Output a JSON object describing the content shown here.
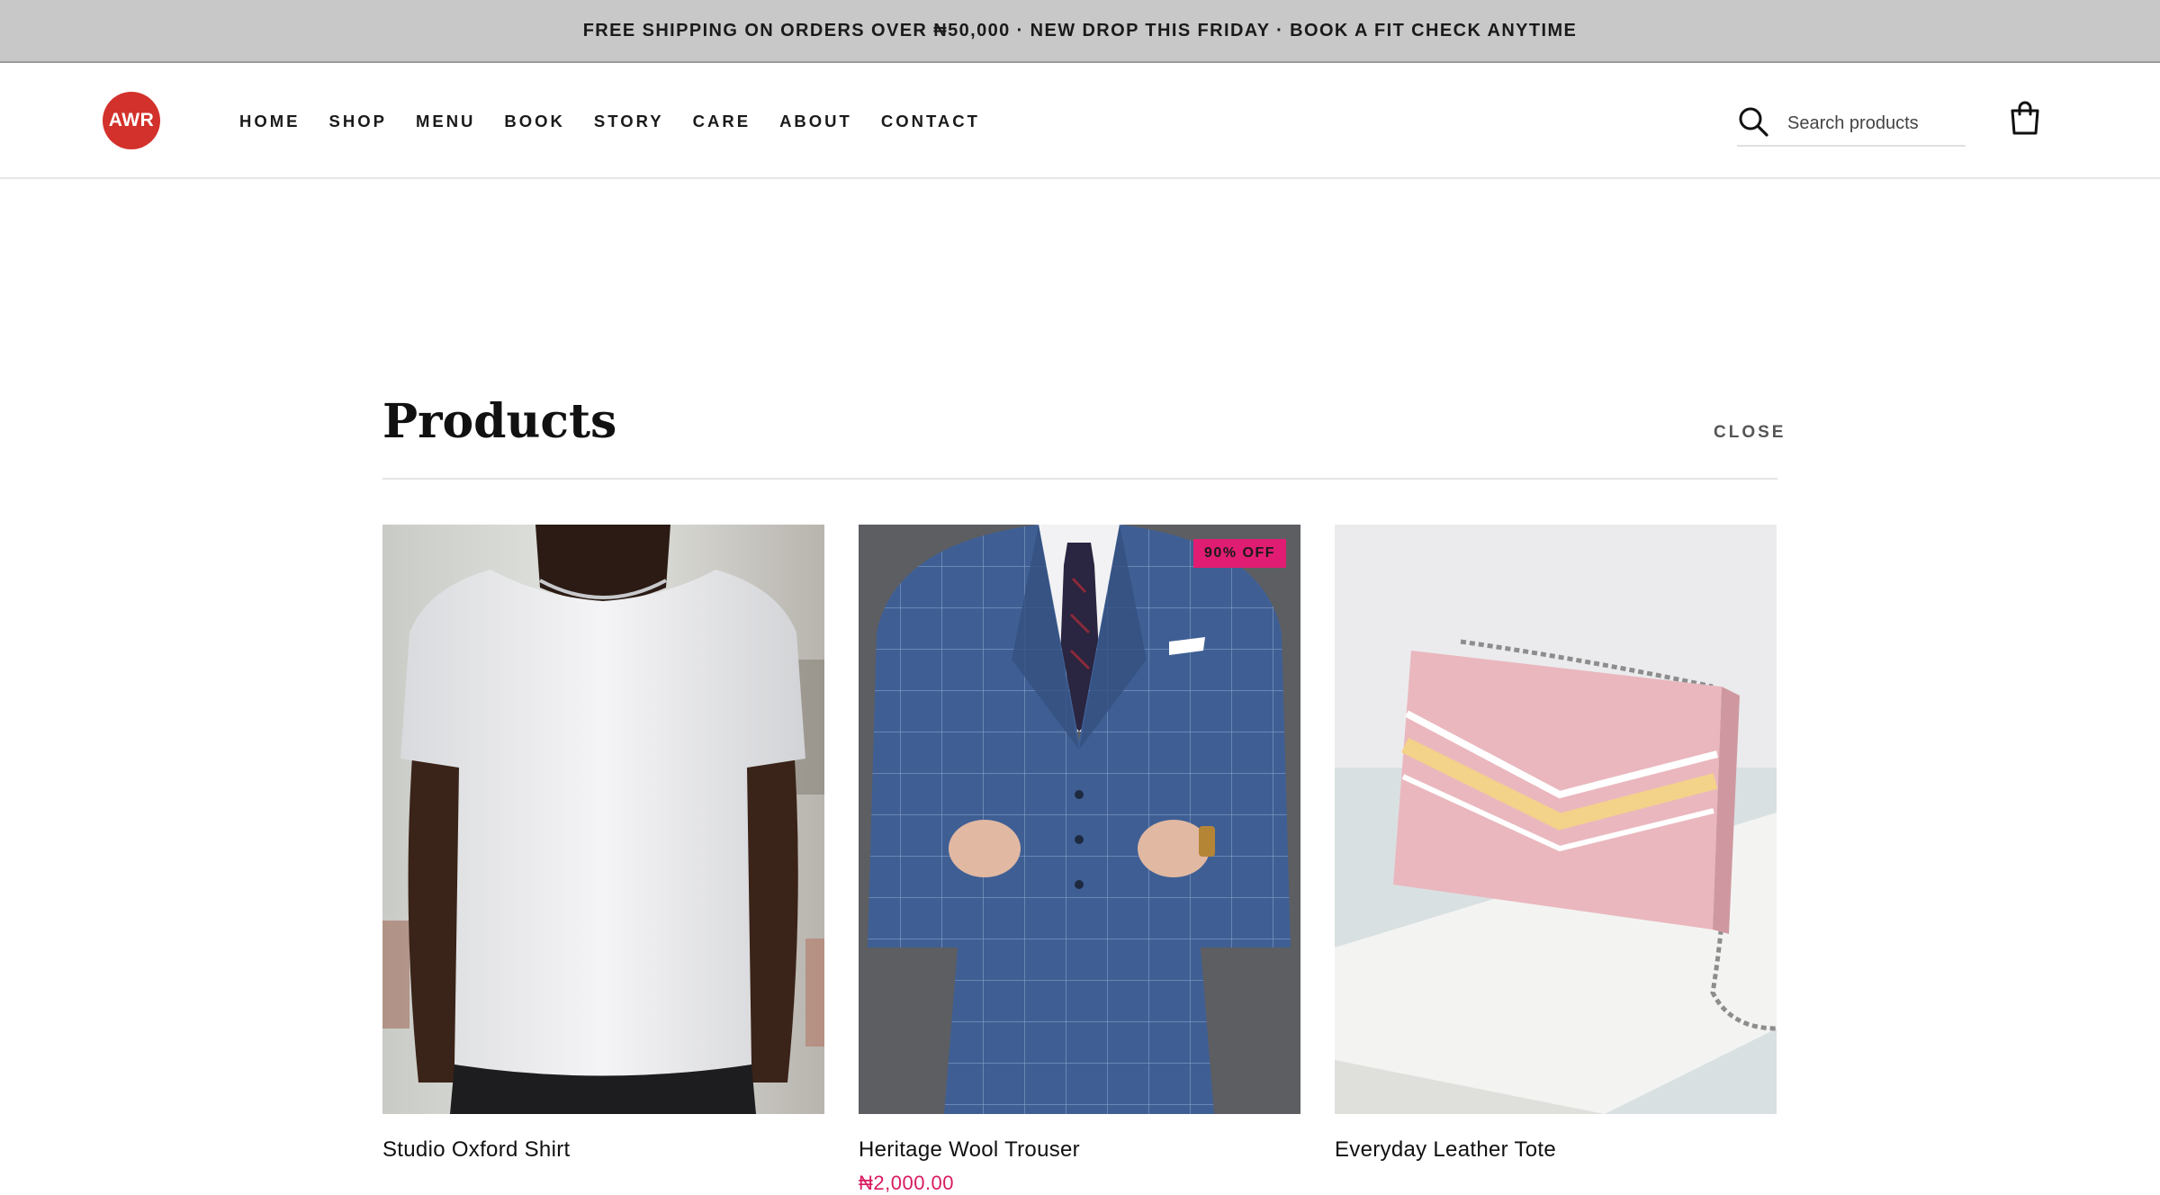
{
  "announcement": "FREE SHIPPING ON ORDERS OVER ₦50,000 · NEW DROP THIS FRIDAY · BOOK A FIT CHECK ANYTIME",
  "header": {
    "logo_text": "AWR",
    "nav": [
      "HOME",
      "SHOP",
      "MENU",
      "BOOK",
      "STORY",
      "CARE",
      "ABOUT",
      "CONTACT"
    ],
    "search_placeholder": "Search products",
    "search_icon": "search-icon",
    "cart_icon": "shopping-bag-icon"
  },
  "panel": {
    "title": "Products",
    "close_label": "CLOSE"
  },
  "products": [
    {
      "name": "Studio Oxford Shirt",
      "image": "white t-shirt on model",
      "badge": "",
      "price": ""
    },
    {
      "name": "Heritage Wool Trouser",
      "image": "blue plaid three-piece suit on model",
      "badge": "90% OFF",
      "price": "₦2,000.00"
    },
    {
      "name": "Everyday Leather Tote",
      "image": "pink chevron handbag with chain strap",
      "badge": "",
      "price": ""
    }
  ],
  "colors": {
    "logo": "#d3312b",
    "badge": "#e01d72",
    "sale_price": "#d81b60",
    "announcement_bg": "#c8c8c8"
  }
}
